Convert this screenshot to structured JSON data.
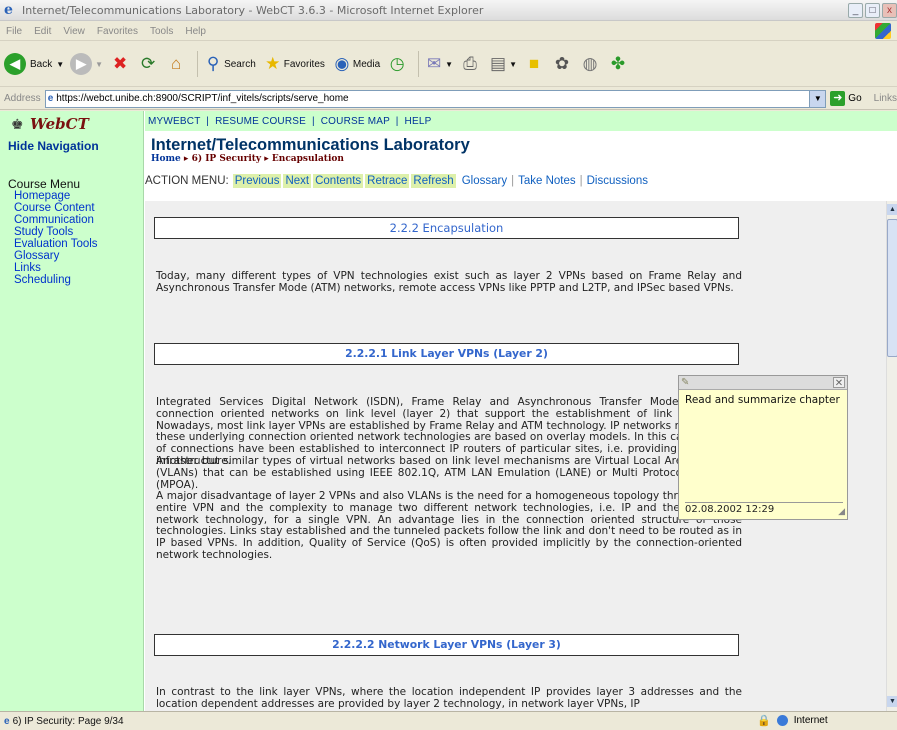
{
  "window": {
    "title": "Internet/Telecommunications Laboratory - WebCT 3.6.3 - Microsoft Internet Explorer",
    "buttons": [
      "_",
      "□",
      "x"
    ]
  },
  "menubar": [
    "File",
    "Edit",
    "View",
    "Favorites",
    "Tools",
    "Help"
  ],
  "toolbar": {
    "back": "Back",
    "search": "Search",
    "favorites": "Favorites",
    "media": "Media"
  },
  "address": {
    "label": "Address",
    "url": "https://webct.unibe.ch:8900/SCRIPT/inf_vitels/scripts/serve_home",
    "go": "Go",
    "links": "Links"
  },
  "webct": {
    "logo": "WebCT",
    "hide_nav": "Hide Navigation",
    "course_menu": "Course Menu",
    "menu_items": [
      "Homepage",
      "Course Content",
      "Communication",
      "Study Tools",
      "Evaluation Tools",
      "Glossary",
      "Links",
      "Scheduling"
    ],
    "topnav": [
      "MYWEBCT",
      "RESUME COURSE",
      "COURSE MAP",
      "HELP"
    ],
    "course_title": "Internet/Telecommunications Laboratory",
    "breadcrumb": [
      "Home",
      "6) IP Security",
      "Encapsulation"
    ],
    "action_label": "ACTION MENU:",
    "action_nav": [
      "Previous",
      "Next",
      "Contents",
      "Retrace",
      "Refresh"
    ],
    "action_links": [
      "Glossary",
      "Take Notes",
      "Discussions"
    ]
  },
  "content": {
    "heading": "2.2.2 Encapsulation",
    "intro": "Today, many different types of VPN technologies exist such as layer 2 VPNs based on Frame Relay and Asynchronous Transfer Mode (ATM) networks, remote access VPNs like PPTP and L2TP, and IPSec based VPNs.",
    "sub1": "2.2.2.1 Link Layer VPNs (Layer 2)",
    "para1": "Integrated Services Digital Network (ISDN), Frame Relay and Asynchronous Transfer Mode (ATM) are connection oriented networks on link level (layer 2) that support the establishment of link layer VPNs. Nowadays, most link layer VPNs are established by Frame Relay and ATM technology. IP networks running over these underlying connection oriented network technologies are based on overlay models. In this case, meshes of connections have been established to interconnect IP routers of particular sites, i.e. providing a tunneling infrastructure.",
    "para2": "Another but similar types of virtual networks based on link level mechanisms are Virtual Local Area Networks (VLANs) that can be established using IEEE 802.1Q, ATM LAN Emulation (LANE) or Multi Protocol Over ATM (MPOA).",
    "para3": "A major disadvantage of layer 2 VPNs and also VLANs is the need for a homogeneous topology throughout the entire VPN and the complexity to manage two different network technologies, i.e. IP and the underlying network technology, for a single VPN. An advantage lies in the connection oriented structure of those technologies. Links stay established and the tunneled packets follow the link and don't need to be routed as in IP based VPNs. In addition, Quality of Service (QoS) is often provided implicitly by the connection-oriented network technologies.",
    "sub2": "2.2.2.2 Network Layer VPNs (Layer 3)",
    "para4": "In contrast to the link layer VPNs, where the location independent IP provides layer 3 addresses and the location dependent addresses are provided by layer 2 technology, in network layer VPNs, IP"
  },
  "note": {
    "text": "Read and summarize chapter",
    "date": "02.08.2002 12:29"
  },
  "status": {
    "text": "6) IP Security: Page 9/34",
    "zone": "Internet"
  }
}
